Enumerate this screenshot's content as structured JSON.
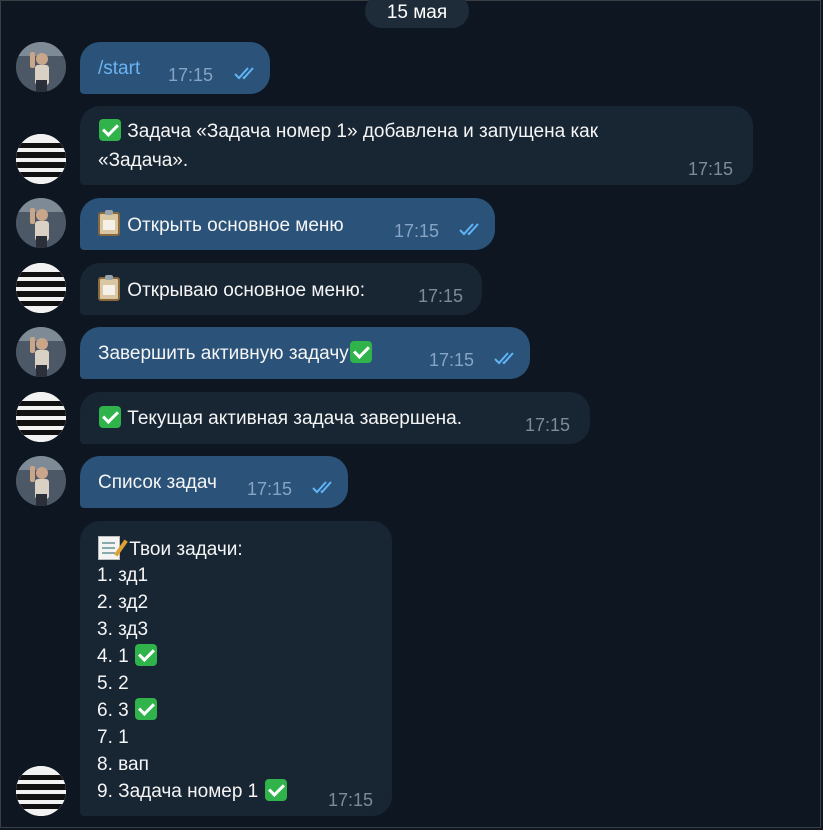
{
  "date_label": "15 мая",
  "messages": [
    {
      "text": "/start",
      "time": "17:15",
      "read": true
    },
    {
      "line1": "Задача «Задача номер 1» добавлена и запущена как",
      "line2": "«Задача».",
      "time": "17:15",
      "emoji": "check"
    },
    {
      "text": "Открыть основное меню",
      "time": "17:15",
      "read": true,
      "emoji": "clipboard"
    },
    {
      "text": "Открываю основное меню:",
      "time": "17:15",
      "emoji": "clipboard"
    },
    {
      "text": "Завершить активную задачу",
      "time": "17:15",
      "read": true,
      "emoji": "check"
    },
    {
      "text": "Текущая активная задача завершена.",
      "time": "17:15",
      "emoji": "check"
    },
    {
      "text": "Список задач",
      "time": "17:15",
      "read": true
    },
    {
      "heading": "Твои задачи:",
      "emoji": "memo",
      "items": [
        "1. зд1",
        "2. зд2",
        "3. зд3",
        "4. 1",
        "5. 2",
        "6. 3",
        "7. 1",
        "8. вап",
        "9. Задача номер 1"
      ],
      "checked_items": [
        4,
        6,
        9
      ],
      "time": "17:15"
    }
  ],
  "colors": {
    "background": "#0e1621",
    "outgoing": "#2b5278",
    "incoming": "#182533",
    "check_blue": "#5eb5f7"
  },
  "icons": {
    "user_avatar": "user-photo-avatar",
    "bot_avatar": "newspaper-text-avatar",
    "read_receipt": "double-check-icon"
  }
}
